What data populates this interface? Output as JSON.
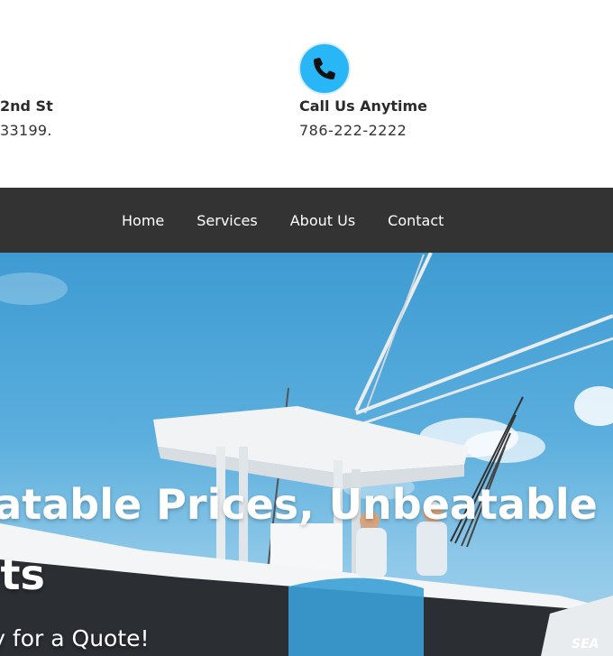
{
  "contact": {
    "address_title": "2nd St",
    "address_line": "33199.",
    "call_title": "Call Us Anytime",
    "call_number": "786-222-2222",
    "phone_icon": "phone-icon",
    "accent_color": "#29b6f6"
  },
  "nav": {
    "items": [
      {
        "label": "Home"
      },
      {
        "label": "Services"
      },
      {
        "label": "About Us"
      },
      {
        "label": "Contact"
      }
    ],
    "background": "#333333"
  },
  "hero": {
    "title_line1": "eatable Prices, Unbeatable",
    "title_line2": "ults",
    "cta_text": "day for a Quote!",
    "boat_brand": "SEA"
  }
}
